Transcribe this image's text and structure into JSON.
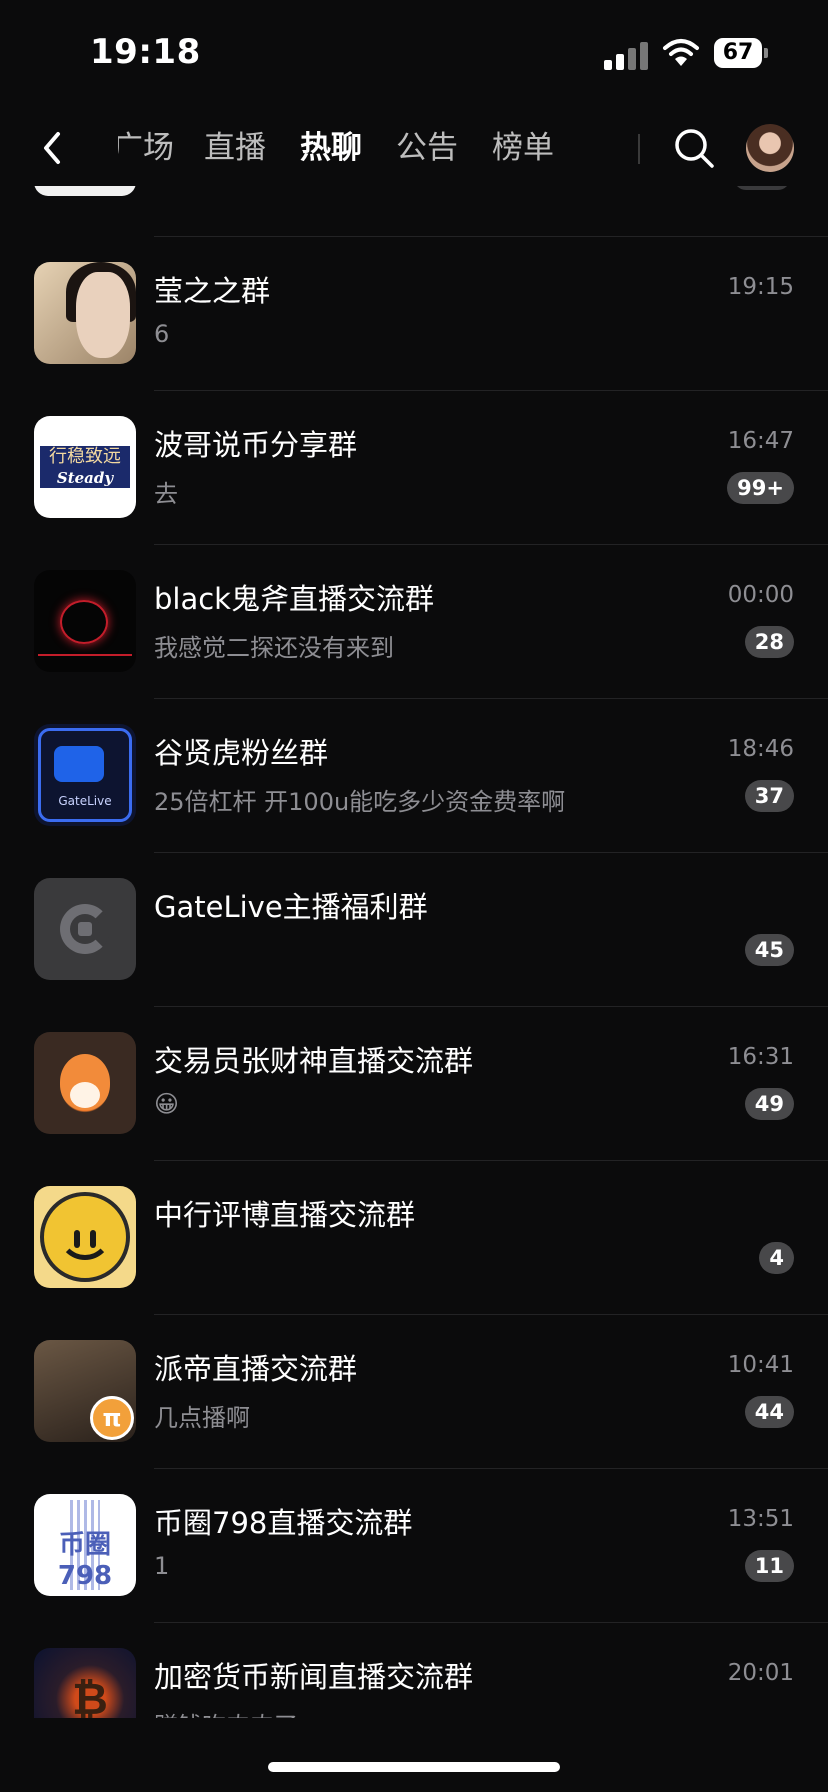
{
  "status_bar": {
    "time": "19:18",
    "battery": "67"
  },
  "nav": {
    "tabs": [
      {
        "label": "广场",
        "active": false
      },
      {
        "label": "直播",
        "active": false
      },
      {
        "label": "热聊",
        "active": true
      },
      {
        "label": "公告",
        "active": false
      },
      {
        "label": "榜单",
        "active": false
      }
    ]
  },
  "chats": [
    {
      "name": "莹之之群",
      "message": "6",
      "time": "19:15",
      "badge": "",
      "thumb": "person"
    },
    {
      "name": "波哥说币分享群",
      "message": "去",
      "time": "16:47",
      "badge": "99+",
      "thumb": "steady",
      "thumb_text_top": "行稳致远",
      "thumb_text_bottom": "Steady"
    },
    {
      "name": "black鬼斧直播交流群",
      "message": "我感觉二探还没有来到",
      "time": "00:00",
      "badge": "28",
      "thumb": "black"
    },
    {
      "name": "谷贤虎粉丝群",
      "message": "25倍杠杆 开100u能吃多少资金费率啊",
      "time": "18:46",
      "badge": "37",
      "thumb": "gatelive",
      "thumb_text": "GateLive"
    },
    {
      "name": "GateLive主播福利群",
      "message": "",
      "time": "",
      "badge": "45",
      "thumb": "g-logo"
    },
    {
      "name": "交易员张财神直播交流群",
      "message": "😀",
      "time": "16:31",
      "badge": "49",
      "thumb": "fox"
    },
    {
      "name": "中行评博直播交流群",
      "message": "",
      "time": "",
      "badge": "4",
      "thumb": "smile"
    },
    {
      "name": "派帝直播交流群",
      "message": "几点播啊",
      "time": "10:41",
      "badge": "44",
      "thumb": "pi",
      "thumb_text": "π"
    },
    {
      "name": "币圈798直播交流群",
      "message": "1",
      "time": "13:51",
      "badge": "11",
      "thumb": "798",
      "thumb_text": "币圈798"
    },
    {
      "name": "加密货币新闻直播交流群",
      "message": "赚钱吃肉肉了",
      "time": "20:01",
      "badge": "",
      "thumb": "btc",
      "thumb_text": "₿"
    }
  ]
}
